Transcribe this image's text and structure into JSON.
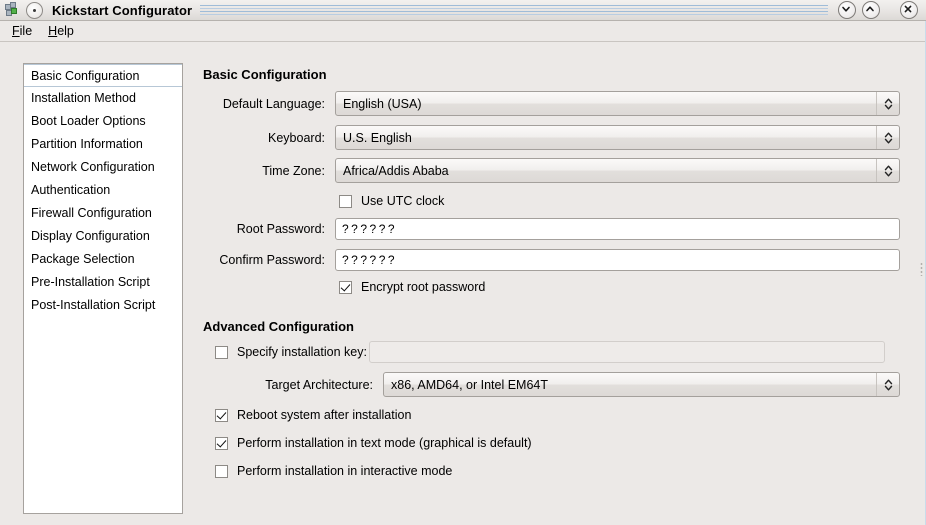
{
  "window": {
    "title": "Kickstart Configurator",
    "app_icon": "kickstart-icon",
    "buttons": {
      "minimize": "minimize-button",
      "maximize": "maximize-button",
      "close": "close-button"
    }
  },
  "menubar": {
    "items": [
      {
        "label": "File",
        "mnemonic": "F",
        "rest": "ile"
      },
      {
        "label": "Help",
        "mnemonic": "H",
        "rest": "elp"
      }
    ]
  },
  "sidebar": {
    "items": [
      {
        "label": "Basic Configuration",
        "selected": true
      },
      {
        "label": "Installation Method",
        "selected": false
      },
      {
        "label": "Boot Loader Options",
        "selected": false
      },
      {
        "label": "Partition Information",
        "selected": false
      },
      {
        "label": "Network Configuration",
        "selected": false
      },
      {
        "label": "Authentication",
        "selected": false
      },
      {
        "label": "Firewall Configuration",
        "selected": false
      },
      {
        "label": "Display Configuration",
        "selected": false
      },
      {
        "label": "Package Selection",
        "selected": false
      },
      {
        "label": "Pre-Installation Script",
        "selected": false
      },
      {
        "label": "Post-Installation Script",
        "selected": false
      }
    ]
  },
  "basic": {
    "heading": "Basic Configuration",
    "default_language": {
      "label": "Default Language:",
      "value": "English (USA)"
    },
    "keyboard": {
      "label": "Keyboard:",
      "value": "U.S. English"
    },
    "time_zone": {
      "label": "Time Zone:",
      "value": "Africa/Addis Ababa"
    },
    "use_utc": {
      "label": "Use UTC clock",
      "checked": false
    },
    "root_password": {
      "label": "Root Password:",
      "value": "??????"
    },
    "confirm_password": {
      "label": "Confirm Password:",
      "value": "??????"
    },
    "encrypt_root": {
      "label": "Encrypt root password",
      "checked": true
    }
  },
  "advanced": {
    "heading": "Advanced Configuration",
    "install_key": {
      "label": "Specify installation key:",
      "checked": false,
      "value": "",
      "enabled": false
    },
    "target_arch": {
      "label": "Target Architecture:",
      "value": "x86, AMD64, or Intel EM64T"
    },
    "reboot": {
      "label": "Reboot system after installation",
      "checked": true
    },
    "text_mode": {
      "label": "Perform installation in text mode (graphical is default)",
      "checked": true
    },
    "interactive": {
      "label": "Perform installation in interactive mode",
      "checked": false
    }
  },
  "colors": {
    "window_background": "#ece9e7",
    "list_background": "#ffffff",
    "border": "#a6a29e",
    "title_stripe": "#9fbcd8"
  }
}
